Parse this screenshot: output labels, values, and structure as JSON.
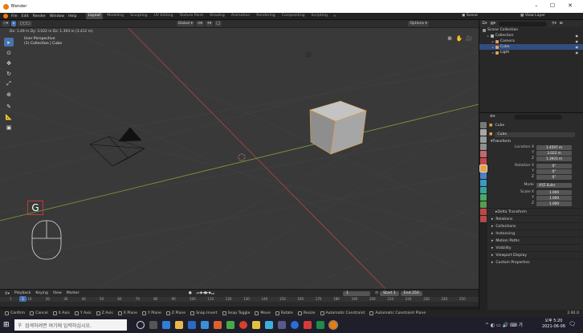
{
  "window": {
    "title": "Blender"
  },
  "topbar": {
    "menus": [
      "File",
      "Edit",
      "Render",
      "Window",
      "Help"
    ],
    "workspaces": [
      "Layout",
      "Modeling",
      "Sculpting",
      "UV Editing",
      "Texture Paint",
      "Shading",
      "Animation",
      "Rendering",
      "Compositing",
      "Scripting"
    ],
    "active_workspace": "Layout",
    "scene_label": "Scene",
    "view_layer_label": "View Layer"
  },
  "viewport": {
    "header": {
      "transform_orientation": "Global",
      "options_label": "Options"
    },
    "dimension_info": "Dx: 1.49 m  Dy: 3.022 m  Dz: 1.393 m (3.412 m)",
    "overlay_lines": [
      "User Perspective",
      "(1) Collection | Cube"
    ],
    "key_indicator": "G",
    "tools": [
      "select",
      "cursor",
      "move",
      "rotate",
      "scale",
      "transform",
      "annotate",
      "measure",
      "add-cube"
    ]
  },
  "outliner": {
    "header_title": "Scene Collection",
    "rows": [
      {
        "label": "Collection",
        "indent": 1,
        "selected": false,
        "color": "#bbbbbb"
      },
      {
        "label": "Camera",
        "indent": 2,
        "selected": false,
        "color": "#e0a060"
      },
      {
        "label": "Cube",
        "indent": 2,
        "selected": true,
        "color": "#e8a060"
      },
      {
        "label": "Light",
        "indent": 2,
        "selected": false,
        "color": "#e0a060"
      }
    ]
  },
  "properties": {
    "object_name": "Cube",
    "object_field": "Cube",
    "transform_label": "Transform",
    "location": {
      "label": "Location X",
      "x": "1.4597 m",
      "y": "3.022 m",
      "z": "1.3933 m"
    },
    "rotation": {
      "label": "Rotation X",
      "x": "0°",
      "y": "0°",
      "z": "0°"
    },
    "mode": {
      "label": "Mode",
      "value": "XYZ Euler"
    },
    "scale": {
      "label": "Scale X",
      "x": "1.000",
      "y": "1.000",
      "z": "1.000"
    },
    "axis_y": "Y",
    "axis_z": "Z",
    "delta_transform": "Delta Transform",
    "sections": [
      "Relations",
      "Collections",
      "Instancing",
      "Motion Paths",
      "Visibility",
      "Viewport Display",
      "Custom Properties"
    ]
  },
  "timeline": {
    "menus": [
      "Playback",
      "Keying",
      "View",
      "Marker"
    ],
    "current_frame": "1",
    "start_label": "Start",
    "start_value": "1",
    "end_label": "End",
    "end_value": "250",
    "ticks": [
      "1",
      "10",
      "20",
      "30",
      "40",
      "50",
      "60",
      "70",
      "80",
      "90",
      "100",
      "110",
      "120",
      "130",
      "140",
      "150",
      "160",
      "170",
      "180",
      "190",
      "200",
      "210",
      "220",
      "230",
      "240",
      "250"
    ]
  },
  "statusbar": {
    "items": [
      "Confirm",
      "Cancel",
      "X Axis",
      "Y Axis",
      "Z Axis",
      "X Plane",
      "Y Plane",
      "Z Plane",
      "Snap Invert",
      "Snap Toggle",
      "Move",
      "Rotate",
      "Resize",
      "Automatic Constraint",
      "Automatic Constraint Plane"
    ],
    "version": "2.92.0"
  },
  "taskbar": {
    "search_placeholder": "검색하려면 여기에 입력하십시오.",
    "time": "오후 5:20",
    "date": "2021-06-06"
  }
}
